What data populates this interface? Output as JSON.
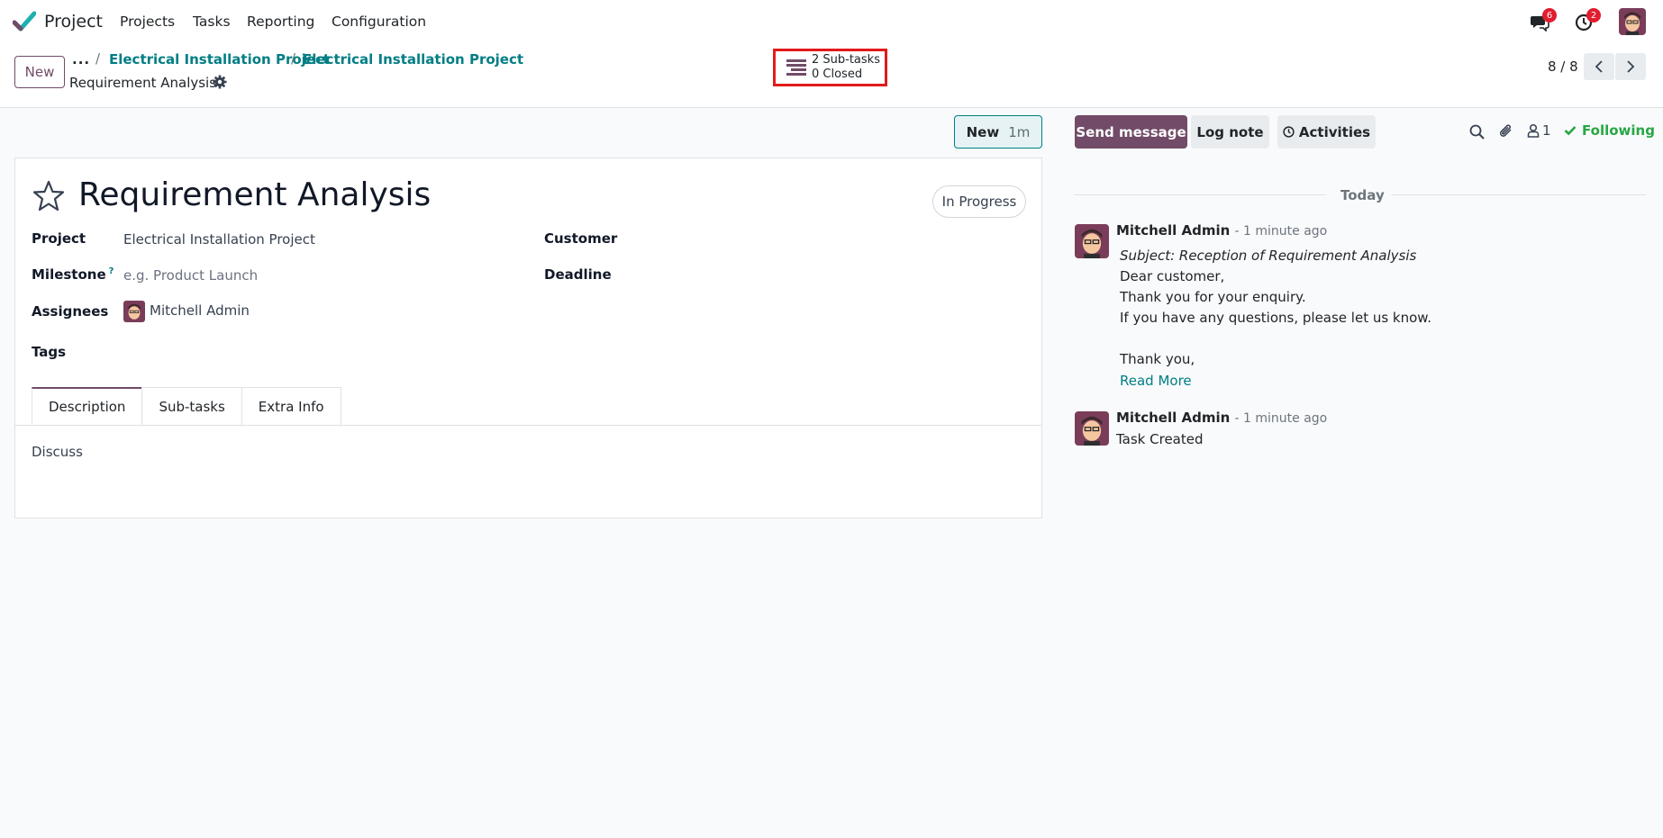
{
  "navbar": {
    "app_name": "Project",
    "menu": [
      "Projects",
      "Tasks",
      "Reporting",
      "Configuration"
    ],
    "messages_badge": "6",
    "activities_badge": "2"
  },
  "control": {
    "new_label": "New",
    "breadcrumb_dots": "...",
    "breadcrumbs": [
      "Electrical Installation Project",
      "Electrical Installation Project"
    ],
    "record_title": "Requirement Analysis",
    "subtasks_stat": {
      "line1": "2 Sub-tasks",
      "line2": "0 Closed"
    },
    "pager": "8 / 8"
  },
  "form": {
    "stage": {
      "label": "New",
      "time": "1m"
    },
    "title": "Requirement Analysis",
    "status": "In Progress",
    "fields": {
      "project_label": "Project",
      "project_value": "Electrical Installation Project",
      "milestone_label": "Milestone",
      "milestone_help": "?",
      "milestone_placeholder": "e.g. Product Launch",
      "assignees_label": "Assignees",
      "assignees_value": "Mitchell Admin",
      "tags_label": "Tags",
      "customer_label": "Customer",
      "deadline_label": "Deadline"
    },
    "tabs": [
      "Description",
      "Sub-tasks",
      "Extra Info"
    ],
    "description": "Discuss"
  },
  "chatter": {
    "send_message": "Send message",
    "log_note": "Log note",
    "activities": "Activities",
    "followers_count": "1",
    "following": "Following",
    "today": "Today",
    "messages": [
      {
        "author": "Mitchell Admin",
        "ago": "- 1 minute ago",
        "subject": "Subject: Reception of Requirement Analysis",
        "lines": [
          "Dear customer,",
          "Thank you for your enquiry.",
          "If you have any questions, please let us know.",
          "Thank you,"
        ],
        "read_more": "Read More"
      },
      {
        "author": "Mitchell Admin",
        "ago": "- 1 minute ago",
        "body": "Task Created"
      }
    ]
  },
  "colors": {
    "brand": "#714b67",
    "link": "#017e84",
    "badge": "#e11d2f",
    "following": "#28a745",
    "highlight": "#e21b1b"
  }
}
